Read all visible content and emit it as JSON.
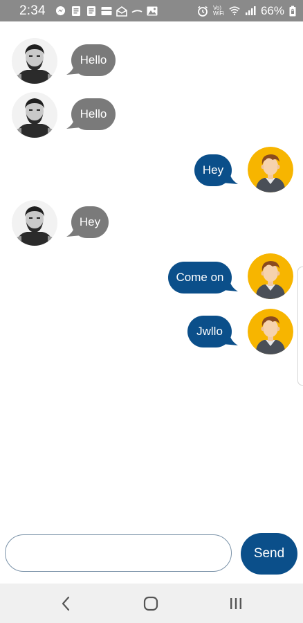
{
  "status_bar": {
    "time": "2:34",
    "left_icons": [
      "messenger-icon",
      "document-icon",
      "document-icon",
      "card-icon",
      "mail-open-icon",
      "swipe-icon",
      "image-icon"
    ],
    "right_icons": [
      "alarm-icon",
      "volte-icon",
      "wifi-icon",
      "signal-icon"
    ],
    "volte_line1": "Vo)",
    "volte_line2": "WiFi",
    "battery_percent": "66%",
    "battery_icon": "battery-locked-icon"
  },
  "chat": {
    "messages": [
      {
        "sender": "other",
        "text": "Hello",
        "avatar": "man-photo-avatar"
      },
      {
        "sender": "other",
        "text": "Hello",
        "avatar": "man-photo-avatar"
      },
      {
        "sender": "me",
        "text": "Hey",
        "avatar": "cartoon-man-avatar"
      },
      {
        "sender": "other",
        "text": "Hey",
        "avatar": "man-photo-avatar"
      },
      {
        "sender": "me",
        "text": "Come on",
        "avatar": "cartoon-man-avatar"
      },
      {
        "sender": "me",
        "text": "Jwllo",
        "avatar": "cartoon-man-avatar"
      }
    ]
  },
  "composer": {
    "input_value": "",
    "input_placeholder": "",
    "send_label": "Send"
  },
  "nav_bar": {
    "back_icon": "back-chevron-icon",
    "home_icon": "home-icon",
    "recents_icon": "recents-icon"
  },
  "colors": {
    "incoming_bubble": "#7a7a7a",
    "outgoing_bubble": "#0b4f8a",
    "send_button": "#0b4f8a",
    "status_bar": "#8a8a8a",
    "avatar_yellow": "#f7b500"
  }
}
